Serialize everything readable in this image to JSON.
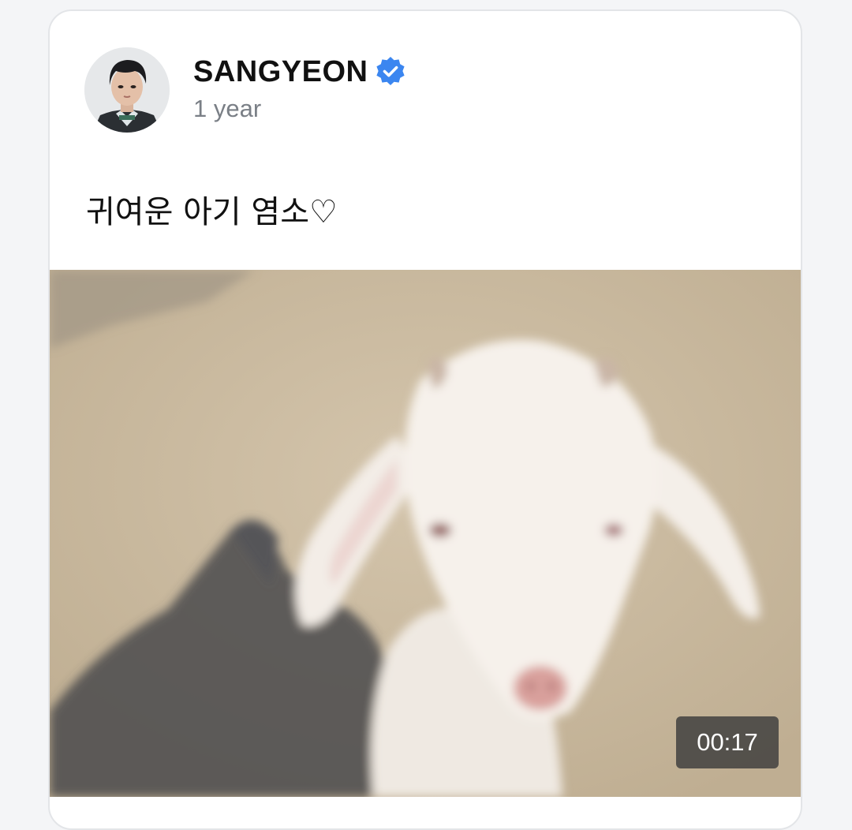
{
  "post": {
    "author": "SANGYEON",
    "timestamp": "1 year",
    "text": "귀여운 아기 염소♡",
    "verified_icon": "verified-badge-icon",
    "verified_color": "#3b86f0",
    "video": {
      "duration": "00:17",
      "subject": "baby goat"
    }
  }
}
